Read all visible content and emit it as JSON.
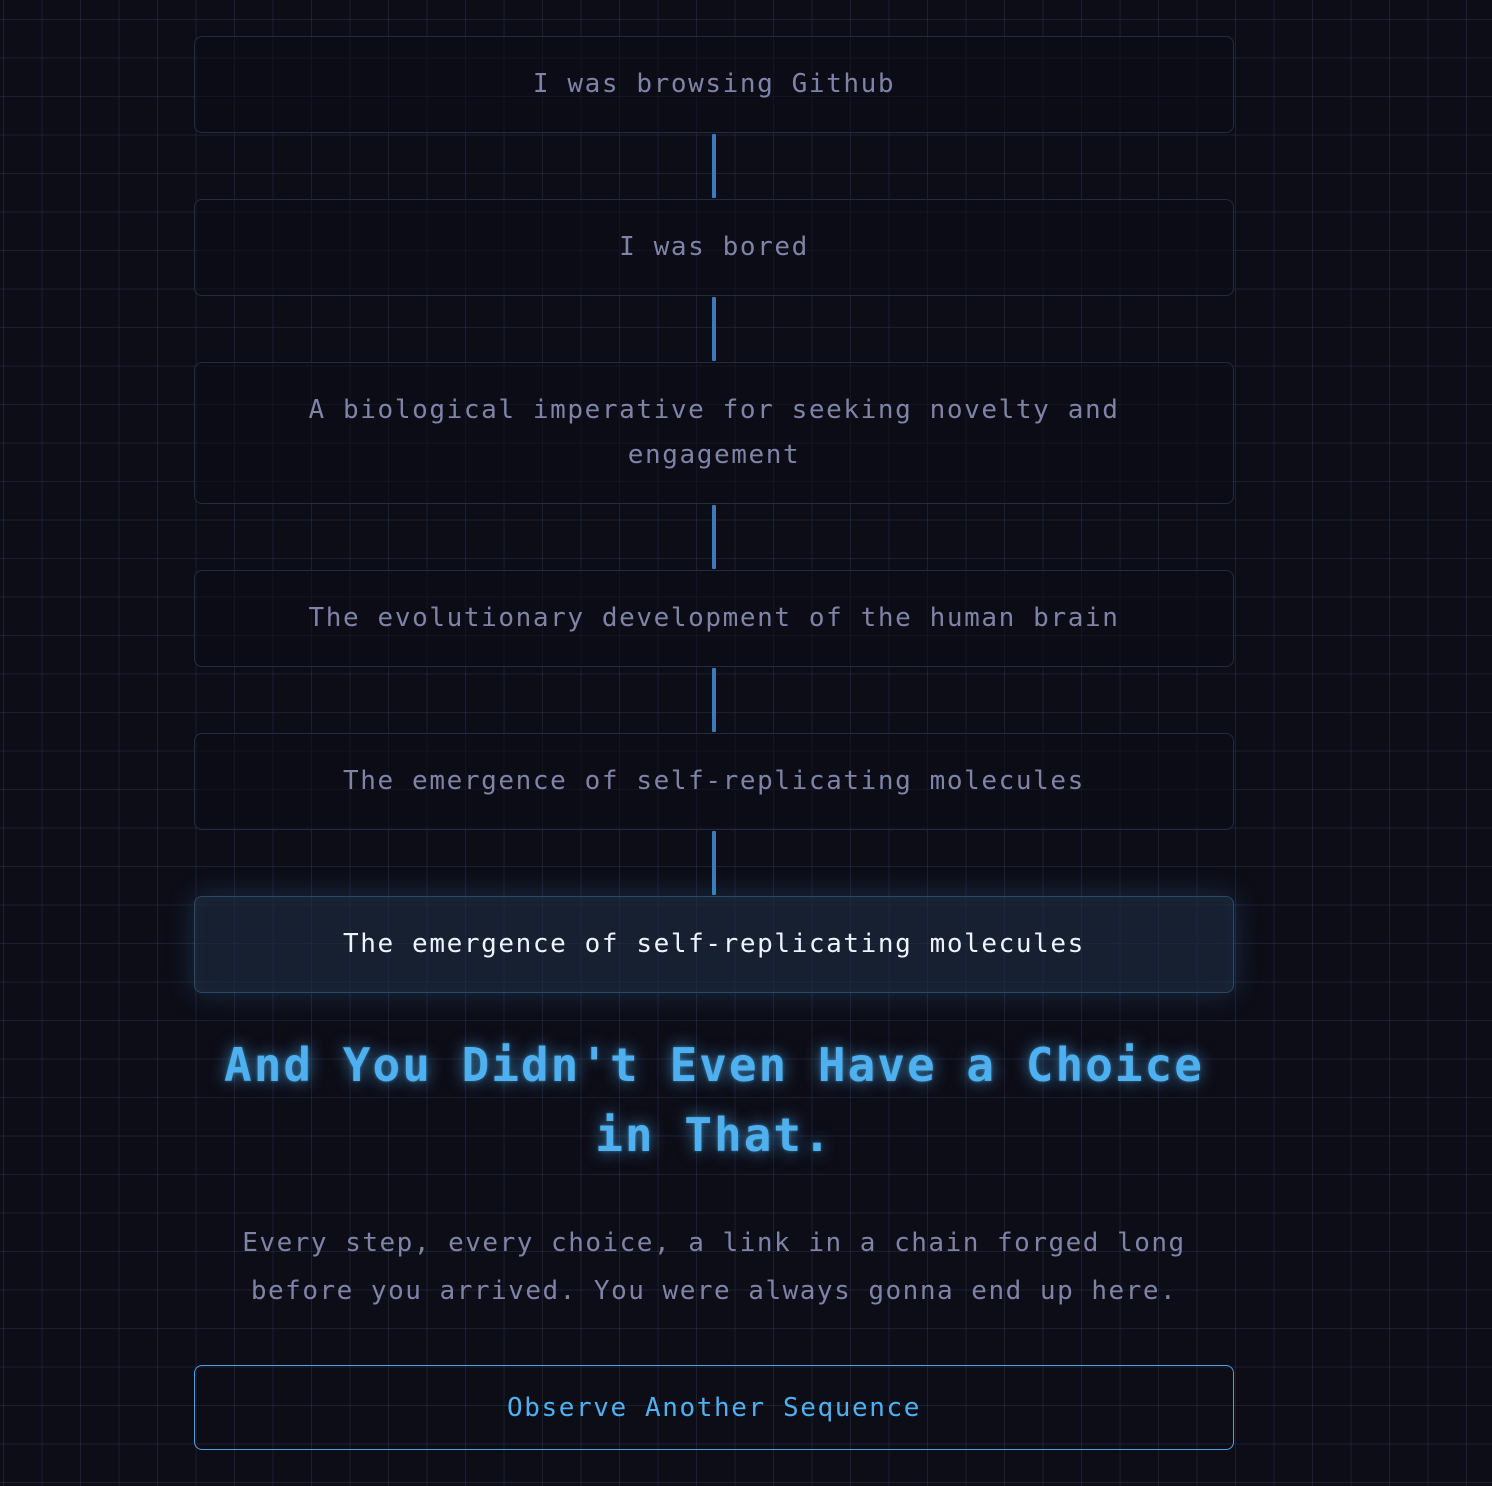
{
  "chain": {
    "steps": [
      "I was browsing Github",
      "I was bored",
      "A biological imperative for seeking novelty and engagement",
      "The evolutionary development of the human brain",
      "The emergence of self-replicating molecules"
    ],
    "final_step": "The emergence of self-replicating molecules"
  },
  "headline": "And You Didn't Even Have a Choice in That.",
  "subtext": "Every step, every choice, a link in a chain forged long before you arrived. You were always gonna end up here.",
  "button": {
    "label": "Observe Another Sequence"
  },
  "colors": {
    "background": "#0d0d17",
    "accent": "#4fb0f0",
    "connector": "#3a7bbf",
    "muted_text": "#7f83a6"
  }
}
